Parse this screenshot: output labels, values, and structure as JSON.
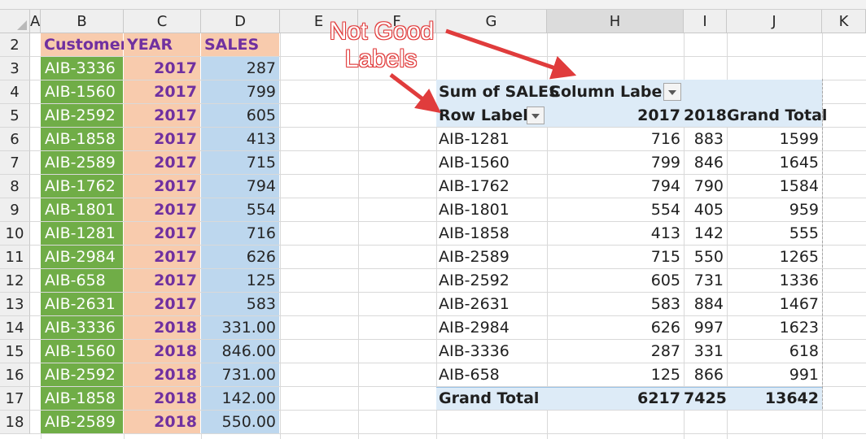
{
  "columns": [
    "A",
    "B",
    "C",
    "D",
    "E",
    "F",
    "G",
    "H",
    "I",
    "J",
    "K"
  ],
  "rows": [
    "2",
    "3",
    "4",
    "5",
    "6",
    "7",
    "8",
    "9",
    "10",
    "11",
    "12",
    "13",
    "14",
    "15",
    "16",
    "17",
    "18"
  ],
  "table_header": {
    "customer": "Customer",
    "year": "YEAR",
    "sales": "SALES"
  },
  "table_rows": [
    {
      "customer": "AIB-3336",
      "year": "2017",
      "sales": "287"
    },
    {
      "customer": "AIB-1560",
      "year": "2017",
      "sales": "799"
    },
    {
      "customer": "AIB-2592",
      "year": "2017",
      "sales": "605"
    },
    {
      "customer": "AIB-1858",
      "year": "2017",
      "sales": "413"
    },
    {
      "customer": "AIB-2589",
      "year": "2017",
      "sales": "715"
    },
    {
      "customer": "AIB-1762",
      "year": "2017",
      "sales": "794"
    },
    {
      "customer": "AIB-1801",
      "year": "2017",
      "sales": "554"
    },
    {
      "customer": "AIB-1281",
      "year": "2017",
      "sales": "716"
    },
    {
      "customer": "AIB-2984",
      "year": "2017",
      "sales": "626"
    },
    {
      "customer": "AIB-658",
      "year": "2017",
      "sales": "125"
    },
    {
      "customer": "AIB-2631",
      "year": "2017",
      "sales": "583"
    },
    {
      "customer": "AIB-3336",
      "year": "2018",
      "sales": "331.00"
    },
    {
      "customer": "AIB-1560",
      "year": "2018",
      "sales": "846.00"
    },
    {
      "customer": "AIB-2592",
      "year": "2018",
      "sales": "731.00"
    },
    {
      "customer": "AIB-1858",
      "year": "2018",
      "sales": "142.00"
    },
    {
      "customer": "AIB-2589",
      "year": "2018",
      "sales": "550.00"
    }
  ],
  "pivot": {
    "value_field": "Sum of SALES",
    "column_labels": "Column Labels",
    "row_labels": "Row Labels",
    "col_headers": [
      "2017",
      "2018",
      "Grand Total"
    ],
    "rows": [
      {
        "label": "AIB-1281",
        "v2017": "716",
        "v2018": "883",
        "total": "1599"
      },
      {
        "label": "AIB-1560",
        "v2017": "799",
        "v2018": "846",
        "total": "1645"
      },
      {
        "label": "AIB-1762",
        "v2017": "794",
        "v2018": "790",
        "total": "1584"
      },
      {
        "label": "AIB-1801",
        "v2017": "554",
        "v2018": "405",
        "total": "959"
      },
      {
        "label": "AIB-1858",
        "v2017": "413",
        "v2018": "142",
        "total": "555"
      },
      {
        "label": "AIB-2589",
        "v2017": "715",
        "v2018": "550",
        "total": "1265"
      },
      {
        "label": "AIB-2592",
        "v2017": "605",
        "v2018": "731",
        "total": "1336"
      },
      {
        "label": "AIB-2631",
        "v2017": "583",
        "v2018": "884",
        "total": "1467"
      },
      {
        "label": "AIB-2984",
        "v2017": "626",
        "v2018": "997",
        "total": "1623"
      },
      {
        "label": "AIB-3336",
        "v2017": "287",
        "v2018": "331",
        "total": "618"
      },
      {
        "label": "AIB-658",
        "v2017": "125",
        "v2018": "866",
        "total": "991"
      }
    ],
    "grand_total": {
      "label": "Grand Total",
      "v2017": "6217",
      "v2018": "7425",
      "total": "13642"
    }
  },
  "annotation": {
    "line1": "Not Good",
    "line2": "Labels"
  },
  "colors": {
    "customer_fill": "#70ad47",
    "year_fill": "#f8cbad",
    "sales_fill": "#bdd7ee",
    "header_text": "#7030a0",
    "pivot_header_fill": "#ddebf7",
    "annotation_arrow": "#e03c3c"
  }
}
